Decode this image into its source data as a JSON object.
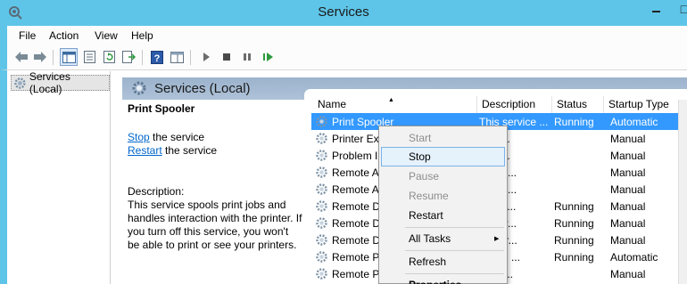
{
  "window": {
    "title": "Services",
    "min_glyph": "—",
    "max_glyph": "□"
  },
  "menubar": {
    "items": [
      "File",
      "Action",
      "View",
      "Help"
    ]
  },
  "toolbar": {
    "icons": [
      "back-arrow-icon",
      "forward-arrow-icon",
      "console-tree-icon",
      "properties-sheet-icon",
      "refresh-icon",
      "export-list-icon",
      "help-icon",
      "console-view-icon",
      "start-service-icon",
      "stop-service-icon",
      "pause-service-icon",
      "restart-service-icon"
    ]
  },
  "tree": {
    "root_label": "Services (Local)"
  },
  "header": {
    "title": "Services (Local)"
  },
  "details": {
    "service_name": "Print Spooler",
    "stop_link": "Stop",
    "stop_suffix": " the service",
    "restart_link": "Restart",
    "restart_suffix": " the service",
    "description_label": "Description:",
    "description_text": "This service spools print jobs and handles interaction with the printer. If you turn off this service, you won't be able to print or see your printers."
  },
  "table": {
    "columns": [
      "Name",
      "Description",
      "Status",
      "Startup Type"
    ],
    "rows": [
      {
        "name": "Print Spooler",
        "description": "This service ...",
        "status": "Running",
        "startup": "Automatic",
        "selected": true
      },
      {
        "name": "Printer Ex",
        "description": "vice ...",
        "status": "",
        "startup": "Manual"
      },
      {
        "name": "Problem I",
        "description": "vice ...",
        "status": "",
        "startup": "Manual"
      },
      {
        "name": "Remote A",
        "description": "s a co...",
        "status": "",
        "startup": "Manual"
      },
      {
        "name": "Remote A",
        "description": "ges di...",
        "status": "",
        "startup": "Manual"
      },
      {
        "name": "Remote D",
        "description": "e Des...",
        "status": "Running",
        "startup": "Manual"
      },
      {
        "name": "Remote D",
        "description": "s user...",
        "status": "Running",
        "startup": "Manual"
      },
      {
        "name": "Remote D",
        "description": "s the r...",
        "status": "Running",
        "startup": "Manual"
      },
      {
        "name": "Remote P",
        "description": "PCSS ...",
        "status": "Running",
        "startup": "Automatic"
      },
      {
        "name": "Remote P",
        "description": "dows...",
        "status": "",
        "startup": "Manual"
      }
    ]
  },
  "context_menu": {
    "start": "Start",
    "stop": "Stop",
    "pause": "Pause",
    "resume": "Resume",
    "restart": "Restart",
    "all_tasks": "All Tasks",
    "refresh": "Refresh",
    "properties": "Properties"
  },
  "colors": {
    "titlebar": "#5ec5e8",
    "selection": "#3399ff",
    "link": "#0066cc"
  }
}
